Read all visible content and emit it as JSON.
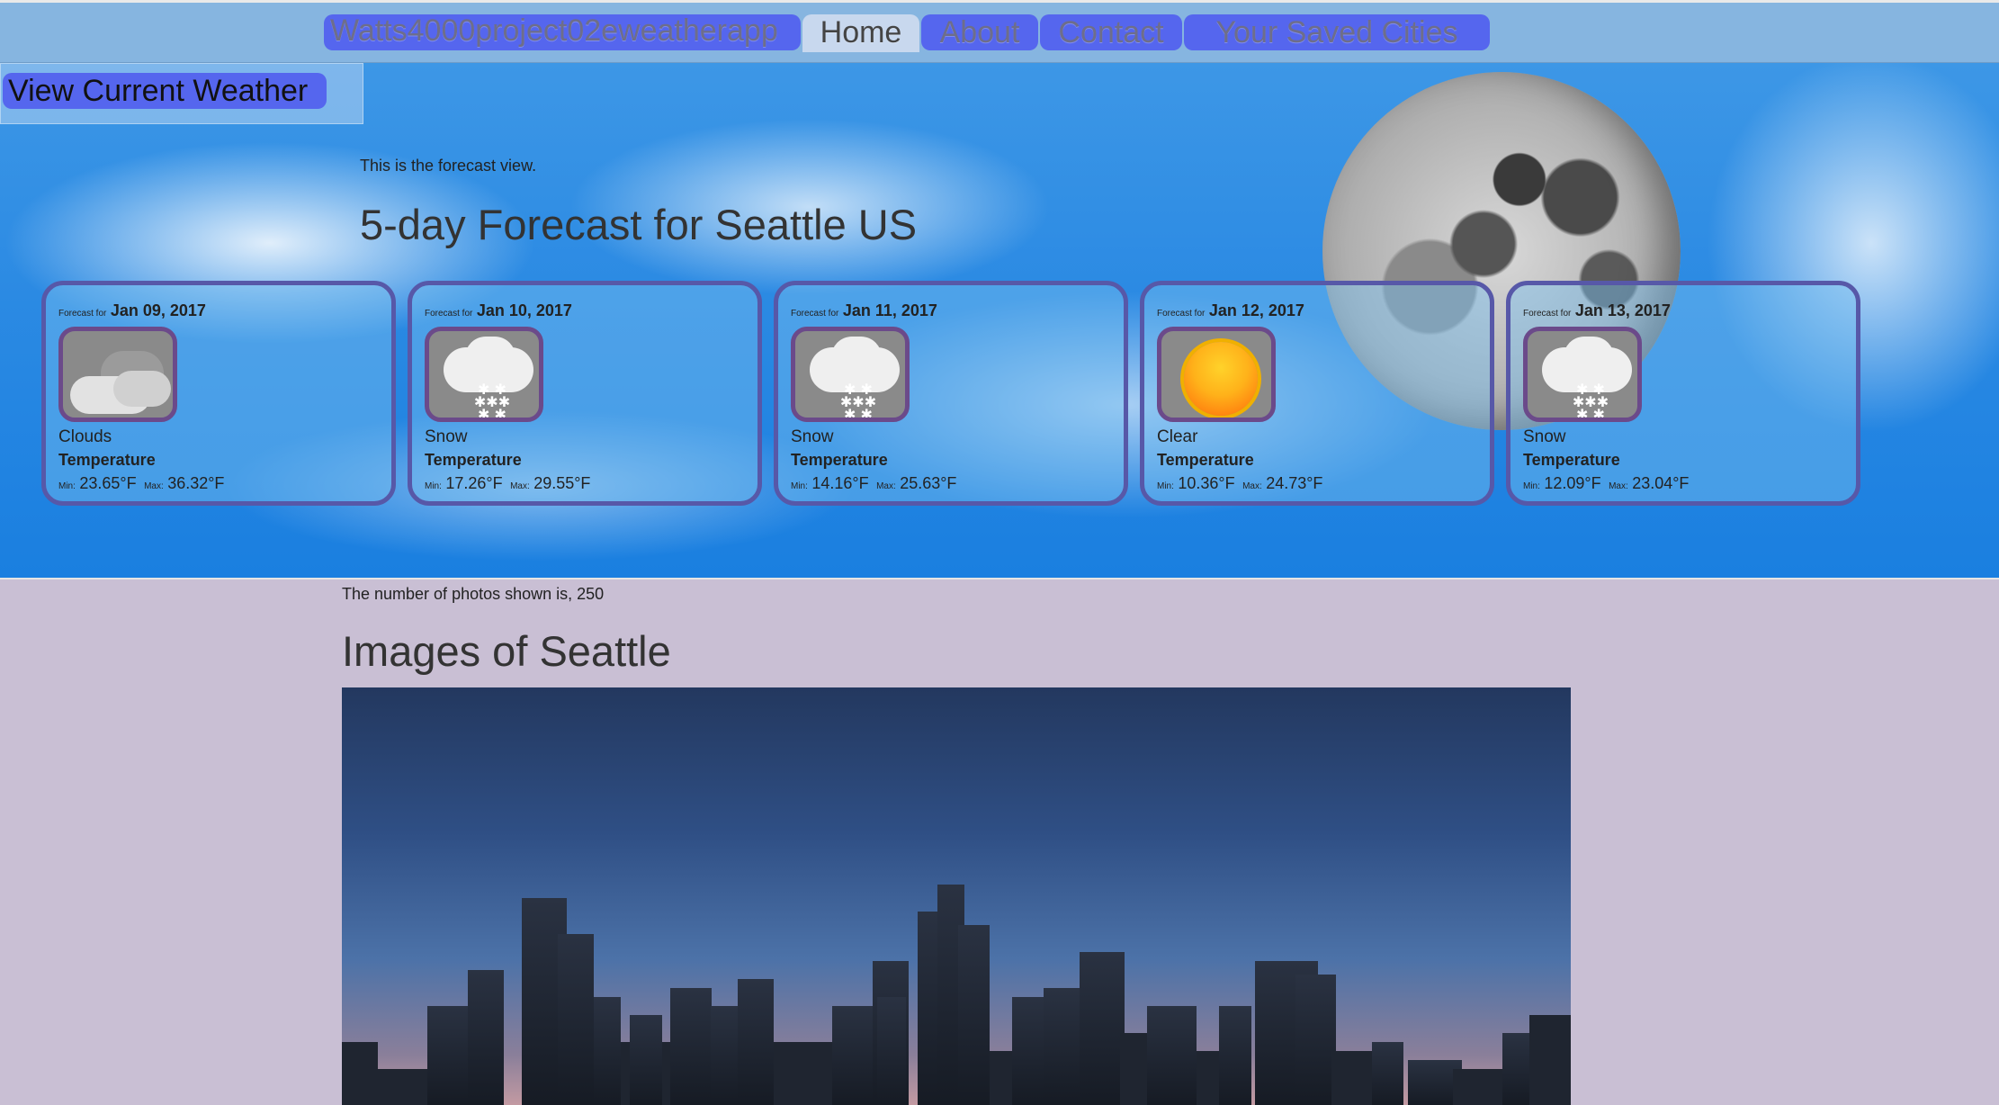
{
  "nav": {
    "brand": "Watts4000project02eweatherapp",
    "items": [
      "Home",
      "About",
      "Contact",
      "Your Saved Cities"
    ]
  },
  "hero": {
    "view_weather_button": "View Current Weather",
    "intro": "This is the forecast view.",
    "title": "5-day Forecast for Seattle US"
  },
  "forecast": {
    "forecast_for_label": "Forecast for",
    "temperature_label": "Temperature",
    "min_label": "Min:",
    "max_label": "Max:",
    "days": [
      {
        "date": "Jan 09, 2017",
        "condition": "Clouds",
        "icon": "clouds-icon",
        "min": "23.65°F",
        "max": "36.32°F"
      },
      {
        "date": "Jan 10, 2017",
        "condition": "Snow",
        "icon": "snow-icon",
        "min": "17.26°F",
        "max": "29.55°F"
      },
      {
        "date": "Jan 11, 2017",
        "condition": "Snow",
        "icon": "snow-icon",
        "min": "14.16°F",
        "max": "25.63°F"
      },
      {
        "date": "Jan 12, 2017",
        "condition": "Clear",
        "icon": "sun-icon",
        "min": "10.36°F",
        "max": "24.73°F"
      },
      {
        "date": "Jan 13, 2017",
        "condition": "Snow",
        "icon": "snow-icon",
        "min": "12.09°F",
        "max": "23.04°F"
      }
    ]
  },
  "images": {
    "count_text": "The number of photos shown is, 250",
    "title": "Images of Seattle"
  },
  "colors": {
    "nav_bg": "#86b5e0",
    "pill": "#5566ee",
    "card_border": "#5758a8",
    "page_bg": "#c9bfd4"
  }
}
